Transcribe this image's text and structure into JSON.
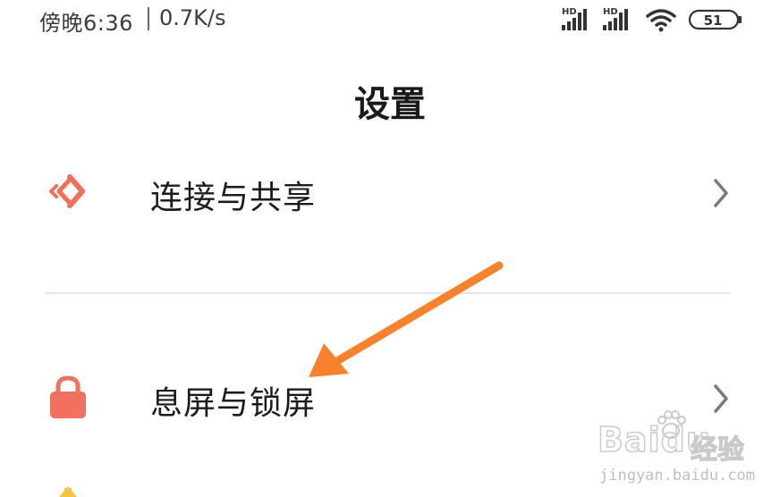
{
  "status_bar": {
    "time": "傍晚6:36",
    "speed": "0.7K/s",
    "network_label_1": "HD",
    "network_label_2": "HD",
    "battery": "51",
    "icons": [
      "hd-signal-icon",
      "hd-signal-icon",
      "wifi-icon",
      "battery-icon"
    ]
  },
  "page": {
    "title": "设置"
  },
  "settings_items": [
    {
      "label": "连接与共享",
      "icon": "connection-share-icon",
      "icon_color": "#f0705a"
    },
    {
      "label": "息屏与锁屏",
      "icon": "lock-icon",
      "icon_color": "#f2705f"
    }
  ],
  "annotation": {
    "arrow_color": "#f7822e"
  },
  "watermark": {
    "brand": "Baidu",
    "jingyan": "经验",
    "url": "jingyan.baidu.com"
  }
}
